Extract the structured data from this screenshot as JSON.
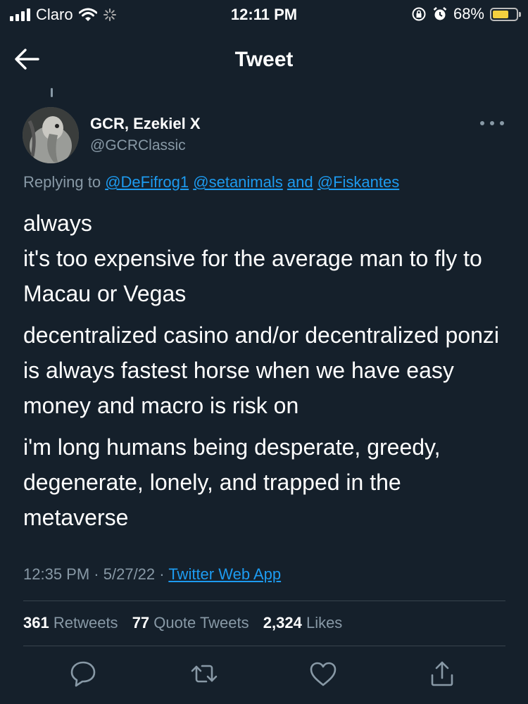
{
  "status_bar": {
    "carrier": "Claro",
    "time": "12:11 PM",
    "battery_percent": "68%",
    "battery_level": 0.68,
    "icons": [
      "signal-icon",
      "wifi-icon",
      "loading-icon",
      "rotation-lock-icon",
      "alarm-icon",
      "battery-icon"
    ]
  },
  "nav": {
    "title": "Tweet",
    "back_icon": "arrow-left-icon"
  },
  "tweet": {
    "author_name": "GCR, Ezekiel X",
    "author_handle": "@GCRClassic",
    "more_icon": "more-horizontal-icon",
    "replying_prefix": "Replying to",
    "replying_to": [
      "@DeFifrog1",
      "@setanimals",
      "@Fiskantes"
    ],
    "replying_and": "and",
    "paragraphs": [
      "always\nit's too expensive for the average man to fly to Macau or Vegas",
      "decentralized casino and/or decentralized ponzi is always fastest horse when we have easy money and macro is risk on",
      "i'm long humans being desperate, greedy, degenerate, lonely, and trapped in the metaverse"
    ],
    "time": "12:35 PM",
    "date": "5/27/22",
    "separator": "·",
    "source": "Twitter Web App"
  },
  "stats": {
    "retweets_count": "361",
    "retweets_label": "Retweets",
    "quotes_count": "77",
    "quotes_label": "Quote Tweets",
    "likes_count": "2,324",
    "likes_label": "Likes"
  },
  "actions": [
    "reply-icon",
    "retweet-icon",
    "like-icon",
    "share-icon"
  ],
  "colors": {
    "background": "#15202b",
    "text": "#ffffff",
    "secondary": "#8899a6",
    "link": "#1d9bf0",
    "divider": "#38444d",
    "battery": "#f4d03f"
  }
}
